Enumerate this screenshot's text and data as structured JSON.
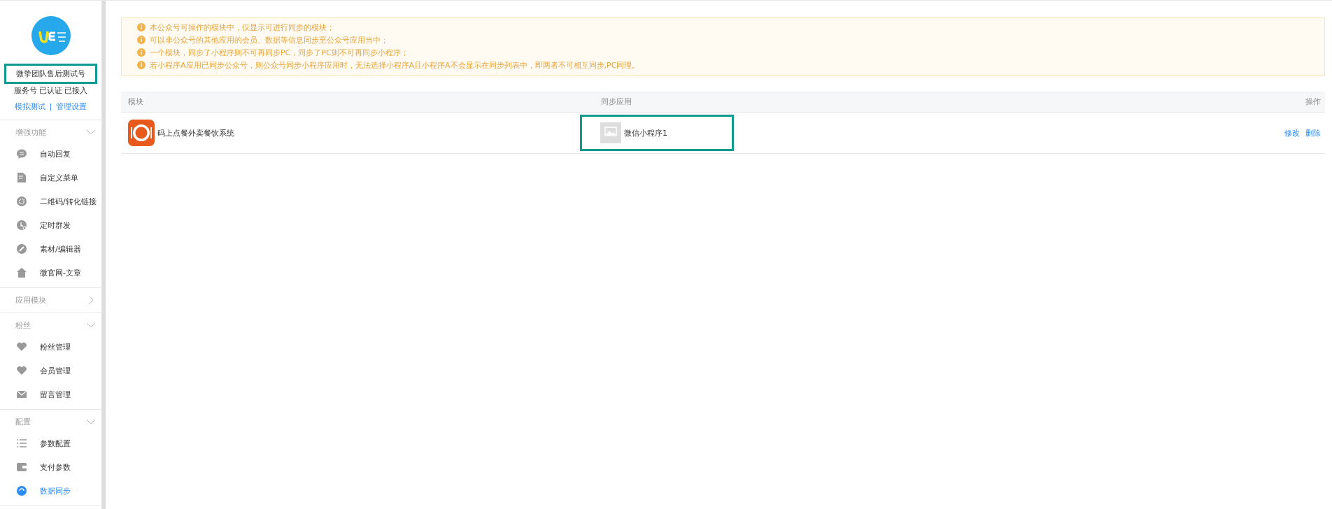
{
  "account": {
    "name": "微挚团队售后测试号",
    "highlighted": true,
    "status": "服务号 已认证 已接入",
    "links": [
      {
        "label": "模拟测试"
      },
      {
        "label": "管理设置"
      }
    ],
    "separator": "|"
  },
  "sidebar": {
    "sections": [
      {
        "title": "增强功能",
        "expanded": true,
        "items": [
          {
            "label": "自动回复",
            "kind": "chat",
            "selected": false
          },
          {
            "label": "自定义菜单",
            "kind": "doc",
            "selected": false
          },
          {
            "label": "二维码/转化链接",
            "kind": "qr",
            "selected": false
          },
          {
            "label": "定时群发",
            "kind": "clock",
            "selected": false
          },
          {
            "label": "素材/编辑器",
            "kind": "pen",
            "selected": false
          },
          {
            "label": "微官网-文章",
            "kind": "home",
            "selected": false
          }
        ]
      },
      {
        "title": "应用模块",
        "expanded": false
      },
      {
        "title": "粉丝",
        "expanded": true,
        "items": [
          {
            "label": "粉丝管理",
            "kind": "heartedit",
            "selected": false
          },
          {
            "label": "会员管理",
            "kind": "heart",
            "selected": false
          },
          {
            "label": "留言管理",
            "kind": "mail",
            "selected": false
          }
        ]
      },
      {
        "title": "配置",
        "expanded": true,
        "items": [
          {
            "label": "参数配置",
            "kind": "list",
            "selected": false
          },
          {
            "label": "支付参数",
            "kind": "wallet",
            "selected": false
          },
          {
            "label": "数据同步",
            "kind": "sync",
            "selected": true
          }
        ]
      }
    ]
  },
  "notices": [
    "本公众号可操作的模块中，仅显示可进行同步的模块；",
    "可以非公众号的其他应用的会员、数据等信息同步至公众号应用当中；",
    "一个模块，同步了小程序则不可再同步PC，同步了PC则不可再同步小程序；",
    "若小程序A应用已同步公众号，则公众号同步小程序应用时，无法选择小程序A且小程序A不会显示在同步列表中，即两者不可相互同步,PC同理。"
  ],
  "table": {
    "columns": [
      "模块",
      "同步应用",
      "操作"
    ],
    "rows": [
      {
        "module": "码上点餐外卖餐饮系统",
        "sync_app": {
          "name": "微信小程序1",
          "highlighted": true
        },
        "actions": [
          "修改",
          "删除"
        ]
      }
    ]
  }
}
